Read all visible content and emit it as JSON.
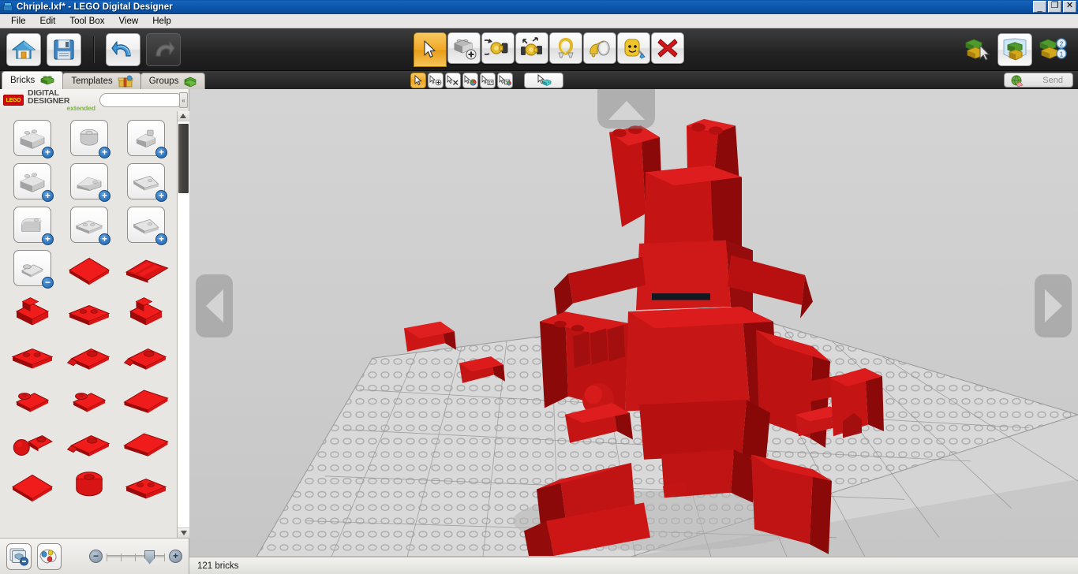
{
  "window": {
    "title": "Chriple.lxf* - LEGO Digital Designer",
    "icon": "lego-brick-icon",
    "controls": {
      "minimize": "_",
      "maximize": "❐",
      "close": "✕"
    }
  },
  "menubar": {
    "items": [
      {
        "label": "File"
      },
      {
        "label": "Edit"
      },
      {
        "label": "Tool Box"
      },
      {
        "label": "View"
      },
      {
        "label": "Help"
      }
    ]
  },
  "toolbar": {
    "left": [
      {
        "name": "home-button",
        "icon": "home-icon",
        "enabled": true
      },
      {
        "name": "save-button",
        "icon": "floppy-disk-icon",
        "enabled": true
      }
    ],
    "history": [
      {
        "name": "undo-button",
        "icon": "undo-arrow-icon",
        "enabled": true
      },
      {
        "name": "redo-button",
        "icon": "redo-arrow-icon",
        "enabled": false
      }
    ],
    "tools": [
      {
        "name": "select-tool",
        "icon": "cursor-arrow-icon",
        "active": true
      },
      {
        "name": "clone-tool",
        "icon": "clone-brick-icon",
        "active": false
      },
      {
        "name": "hinge-tool",
        "icon": "hinge-rotate-icon",
        "active": false
      },
      {
        "name": "flex-tool",
        "icon": "flex-hinge-icon",
        "active": false
      },
      {
        "name": "hinge-align-tool",
        "icon": "hinge-align-icon",
        "active": false
      },
      {
        "name": "paint-tool",
        "icon": "paint-bucket-icon",
        "active": false
      },
      {
        "name": "decorate-tool",
        "icon": "minifig-decorate-icon",
        "active": false
      },
      {
        "name": "delete-tool",
        "icon": "red-x-icon",
        "active": false
      }
    ],
    "modes": [
      {
        "name": "build-mode-button",
        "icon": "build-mode-icon",
        "active": false
      },
      {
        "name": "view-mode-button",
        "icon": "view-mode-icon",
        "active": true
      },
      {
        "name": "guide-mode-button",
        "icon": "building-guide-icon",
        "active": false,
        "badges": [
          "2",
          "1"
        ]
      }
    ]
  },
  "tabs": [
    {
      "label": "Bricks",
      "icon": "green-brick-icon",
      "active": true
    },
    {
      "label": "Templates",
      "icon": "template-box-icon",
      "active": false
    },
    {
      "label": "Groups",
      "icon": "stacked-bricks-icon",
      "active": false
    }
  ],
  "subtoolbar": {
    "buttons": [
      {
        "name": "select-single-tool",
        "icon": "cursor-icon",
        "active": true
      },
      {
        "name": "select-add-tool",
        "icon": "cursor-plus-icon",
        "active": false
      },
      {
        "name": "select-connected-tool",
        "icon": "cursor-connected-icon",
        "active": false
      },
      {
        "name": "select-same-color-tool",
        "icon": "cursor-color-icon",
        "active": false
      },
      {
        "name": "select-same-shape-tool",
        "icon": "cursor-shape-icon",
        "active": false
      },
      {
        "name": "select-shape-color-tool",
        "icon": "cursor-shape-color-icon",
        "active": false
      },
      {
        "name": "select-all-tool",
        "icon": "cursor-all-bricks-icon",
        "active": false
      }
    ],
    "send": {
      "label": "Send",
      "icon": "globe-icon",
      "enabled": false
    }
  },
  "sidebar": {
    "brand": {
      "logo": "LEGO",
      "line1": "DIGITAL DESIGNER",
      "line2": "extended"
    },
    "search": {
      "value": "",
      "placeholder": ""
    },
    "collapse": {
      "label": "«",
      "name": "collapse-panel-button"
    },
    "palette": {
      "items": [
        {
          "name": "brick-category-2x4",
          "icon": "grey-brick-2x4",
          "badge": "+",
          "color": "grey"
        },
        {
          "name": "brick-category-round",
          "icon": "grey-round-brick",
          "badge": "+",
          "color": "grey"
        },
        {
          "name": "brick-category-special",
          "icon": "grey-special-brick",
          "badge": "+",
          "color": "grey"
        },
        {
          "name": "brick-category-1x4",
          "icon": "grey-brick-1x4",
          "badge": "+",
          "color": "grey"
        },
        {
          "name": "brick-category-slope",
          "icon": "grey-slope-brick",
          "badge": "+",
          "color": "grey"
        },
        {
          "name": "brick-category-wedge",
          "icon": "grey-wedge-brick",
          "badge": "+",
          "color": "grey"
        },
        {
          "name": "brick-category-curved",
          "icon": "grey-curved-brick",
          "badge": "+",
          "color": "grey"
        },
        {
          "name": "brick-category-plate-2x2",
          "icon": "grey-plate-2x2",
          "badge": "+",
          "color": "grey"
        },
        {
          "name": "brick-category-wedge-plate",
          "icon": "grey-wedge-plate",
          "badge": "+",
          "color": "grey"
        },
        {
          "name": "brick-category-hinge-open",
          "icon": "grey-hinge-brick",
          "badge": "−",
          "color": "grey"
        },
        {
          "name": "brick-red-plate-4x4",
          "icon": "red-plate-4x4",
          "badge": "",
          "color": "red"
        },
        {
          "name": "brick-red-grille",
          "icon": "red-grille-plate",
          "badge": "",
          "color": "red"
        },
        {
          "name": "brick-red-bracket",
          "icon": "red-bracket",
          "badge": "",
          "color": "red"
        },
        {
          "name": "brick-red-plate-2x4",
          "icon": "red-plate-2x4",
          "badge": "",
          "color": "red"
        },
        {
          "name": "brick-red-bracket-2",
          "icon": "red-bracket-alt",
          "badge": "",
          "color": "red"
        },
        {
          "name": "brick-red-plate-2x4b",
          "icon": "red-plate-2x4-alt",
          "badge": "",
          "color": "red"
        },
        {
          "name": "brick-red-clip-plate",
          "icon": "red-clip-plate",
          "badge": "",
          "color": "red"
        },
        {
          "name": "brick-red-clip-plate-2",
          "icon": "red-clip-plate-alt",
          "badge": "",
          "color": "red"
        },
        {
          "name": "brick-red-hinge-plate",
          "icon": "red-hinge-plate",
          "badge": "",
          "color": "red"
        },
        {
          "name": "brick-red-hinge-plate-2",
          "icon": "red-hinge-plate-alt",
          "badge": "",
          "color": "red"
        },
        {
          "name": "brick-red-plate-1x4",
          "icon": "red-plate-1x4",
          "badge": "",
          "color": "red"
        },
        {
          "name": "brick-red-ball-joint",
          "icon": "red-ball-joint",
          "badge": "",
          "color": "red"
        },
        {
          "name": "brick-red-socket-plate",
          "icon": "red-socket-plate",
          "badge": "",
          "color": "red"
        },
        {
          "name": "brick-red-plate-1x6",
          "icon": "red-plate-1x6",
          "badge": "",
          "color": "red"
        },
        {
          "name": "brick-red-plate-6x6",
          "icon": "red-plate-6x6",
          "badge": "",
          "color": "red"
        },
        {
          "name": "brick-red-round-plate",
          "icon": "red-round-plate",
          "badge": "",
          "color": "red"
        },
        {
          "name": "brick-red-modified-plate",
          "icon": "red-modified-plate",
          "badge": "",
          "color": "red"
        }
      ]
    },
    "bottom": {
      "hide_bricks_button": {
        "name": "hide-bricks-button",
        "icon": "layers-minus-icon"
      },
      "color_palette_button": {
        "name": "color-palette-button",
        "icon": "paint-palette-icon"
      },
      "zoom": {
        "out_label": "−",
        "in_label": "+",
        "value": 65
      }
    }
  },
  "viewport": {
    "nav": {
      "up": {
        "name": "rotate-up-button",
        "icon": "triangle-up-icon"
      },
      "left": {
        "name": "rotate-left-button",
        "icon": "triangle-left-icon"
      },
      "right": {
        "name": "rotate-right-button",
        "icon": "triangle-right-icon"
      }
    },
    "model": {
      "description": "red-lego-creature",
      "brick_color": "#cc1111",
      "baseplate_color": "#d8d8d8"
    }
  },
  "statusbar": {
    "text": "121 bricks"
  },
  "colors": {
    "title_blue": "#0d57ad",
    "toolbar_dark": "#2b2b2b",
    "accent_orange": "#efa423",
    "lego_red": "#d10a11",
    "brick_red": "#cc1111",
    "brick_red_dark": "#8e0a0a",
    "panel_grey": "#e8e6e2",
    "viewport_grey": "#cfcfcf"
  }
}
